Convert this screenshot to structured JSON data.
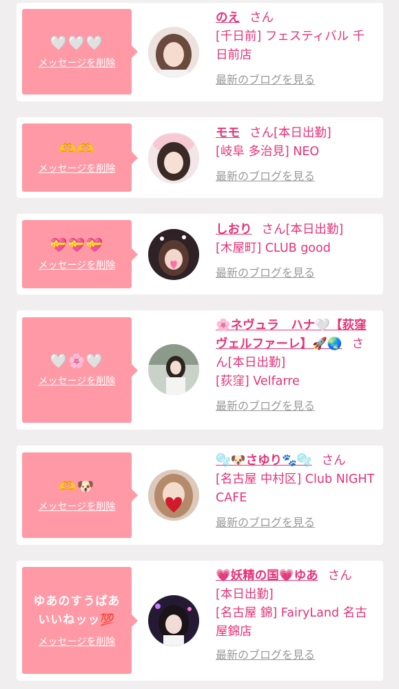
{
  "items": [
    {
      "message": "🤍🤍🤍",
      "delete_label": "メッセージを削除",
      "name": "のえ",
      "honorific": "さん",
      "status": "",
      "shop_lines": [
        "[千日前] フェスティバル 千日前店"
      ],
      "blog_label": "最新のブログを見る",
      "avatar_color": "#e8d8d4"
    },
    {
      "message": "🫶🫶",
      "delete_label": "メッセージを削除",
      "name": "モモ",
      "honorific": "さん",
      "status": "[本日出勤]",
      "shop_lines": [
        "[岐阜 多治見] NEO"
      ],
      "blog_label": "最新のブログを見る",
      "avatar_color": "#f0dde0"
    },
    {
      "message": "💝💝💝",
      "delete_label": "メッセージを削除",
      "name": "しおり",
      "honorific": "さん",
      "status": "[本日出勤]",
      "shop_lines": [
        "[木屋町] CLUB good"
      ],
      "blog_label": "最新のブログを見る",
      "avatar_color": "#3b2a30"
    },
    {
      "message": "🤍🌸🤍",
      "delete_label": "メッセージを削除",
      "name": "🌸ネヴュラ　ハナ🤍【荻窪ヴェルファーレ】🚀🌏",
      "honorific": "さん",
      "status": "[本日出勤]",
      "shop_lines": [
        "[荻窪] Velfarre"
      ],
      "blog_label": "最新のブログを見る",
      "avatar_color": "#cfd6cf"
    },
    {
      "message": "🫶🐶",
      "delete_label": "メッセージを削除",
      "name": "🫧🐶さゆり🐾🫧",
      "honorific": "さん",
      "status": "",
      "shop_lines": [
        "[名古屋 中村区] Club NIGHT CAFE"
      ],
      "blog_label": "最新のブログを見る",
      "avatar_color": "#d8c4b8"
    },
    {
      "message": "ゆあのすうぱあいいねッッ💯",
      "delete_label": "メッセージを削除",
      "name": "💗妖精の国💗ゆあ",
      "honorific": "さん",
      "status": "[本日出勤]",
      "shop_lines": [
        "[名古屋 錦] FairyLand 名古屋錦店"
      ],
      "blog_label": "最新のブログを見る",
      "avatar_color": "#2a1f3a"
    }
  ]
}
